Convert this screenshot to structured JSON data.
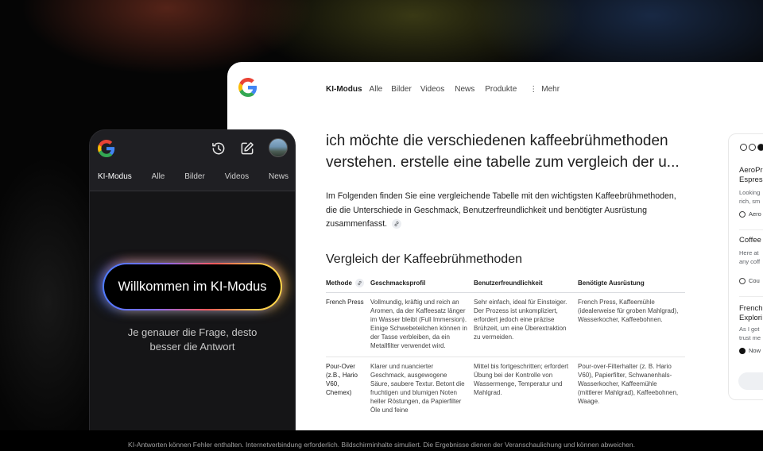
{
  "desktop": {
    "tabs": [
      {
        "label": "KI-Modus",
        "active": true
      },
      {
        "label": "Alle"
      },
      {
        "label": "Bilder"
      },
      {
        "label": "Videos"
      },
      {
        "label": "News"
      },
      {
        "label": "Produkte"
      }
    ],
    "more_label": "Mehr",
    "query": "ich möchte die verschiedenen kaffeebrühmethoden verstehen. erstelle eine tabelle zum vergleich der u...",
    "intro": "Im Folgenden finden Sie eine vergleichende Tabelle mit den wichtigsten Kaffeebrühmethoden, die die Unterschiede in Geschmack, Benutzerfreundlichkeit und benötigter Ausrüstung zusammenfasst.",
    "table_heading": "Vergleich der Kaffeebrühmethoden",
    "table": {
      "headers": [
        "Methode",
        "Geschmacksprofil",
        "Benutzerfreundlichkeit",
        "Benötigte Ausrüstung"
      ],
      "rows": [
        {
          "method": "French Press",
          "flavor": "Vollmundig, kräftig und reich an Aromen, da der Kaffeesatz länger im Wasser bleibt (Full Immersion). Einige Schwebeteilchen können in der Tasse verbleiben, da ein Metallfilter verwendet wird.",
          "ease": "Sehr einfach, ideal für Einsteiger. Der Prozess ist unkompliziert, erfordert jedoch eine präzise Brühzeit, um eine Überextraktion zu vermeiden.",
          "equipment": "French Press, Kaffeemühle (idealerweise für groben Mahlgrad), Wasserkocher, Kaffeebohnen."
        },
        {
          "method": "Pour-Over (z.B., Hario V60, Chemex)",
          "flavor": "Klarer und nuancierter Geschmack, ausgewogene Säure, saubere Textur. Betont die fruchtigen und blumigen Noten heller Röstungen, da Papierfilter Öle und feine",
          "ease": "Mittel bis fortgeschritten; erfordert Übung bei der Kontrolle von Wassermenge, Temperatur und Mahlgrad.",
          "equipment": "Pour-over-Filterhalter (z. B. Hario V60), Papierfilter, Schwanenhals-Wasserkocher, Kaffeemühle (mittlerer Mahlgrad), Kaffeebohnen, Waage."
        }
      ]
    },
    "side_cards": [
      {
        "title1": "AeroPr",
        "title2": "Espres",
        "snip1": "Looking",
        "snip2": "rich, sm",
        "source": "Aero"
      },
      {
        "title1": "Coffee",
        "snip1": "Here at",
        "snip2": "any coff",
        "source": "Cou"
      },
      {
        "title1": "French",
        "title2": "Explori",
        "snip1": "As I got",
        "snip2": "trust me",
        "source": "Now"
      }
    ]
  },
  "phone": {
    "tabs": [
      {
        "label": "KI-Modus",
        "active": true
      },
      {
        "label": "Alle"
      },
      {
        "label": "Bilder"
      },
      {
        "label": "Videos"
      },
      {
        "label": "News"
      }
    ],
    "welcome": "Willkommen im KI-Modus",
    "subtitle_line1": "Je genauer die Frage, desto",
    "subtitle_line2": "besser die Antwort"
  },
  "disclaimer": "KI-Antworten können Fehler enthalten. Internetverbindung erforderlich. Bildschirminhalte simuliert. Die Ergebnisse dienen der Veranschaulichung und können abweichen."
}
